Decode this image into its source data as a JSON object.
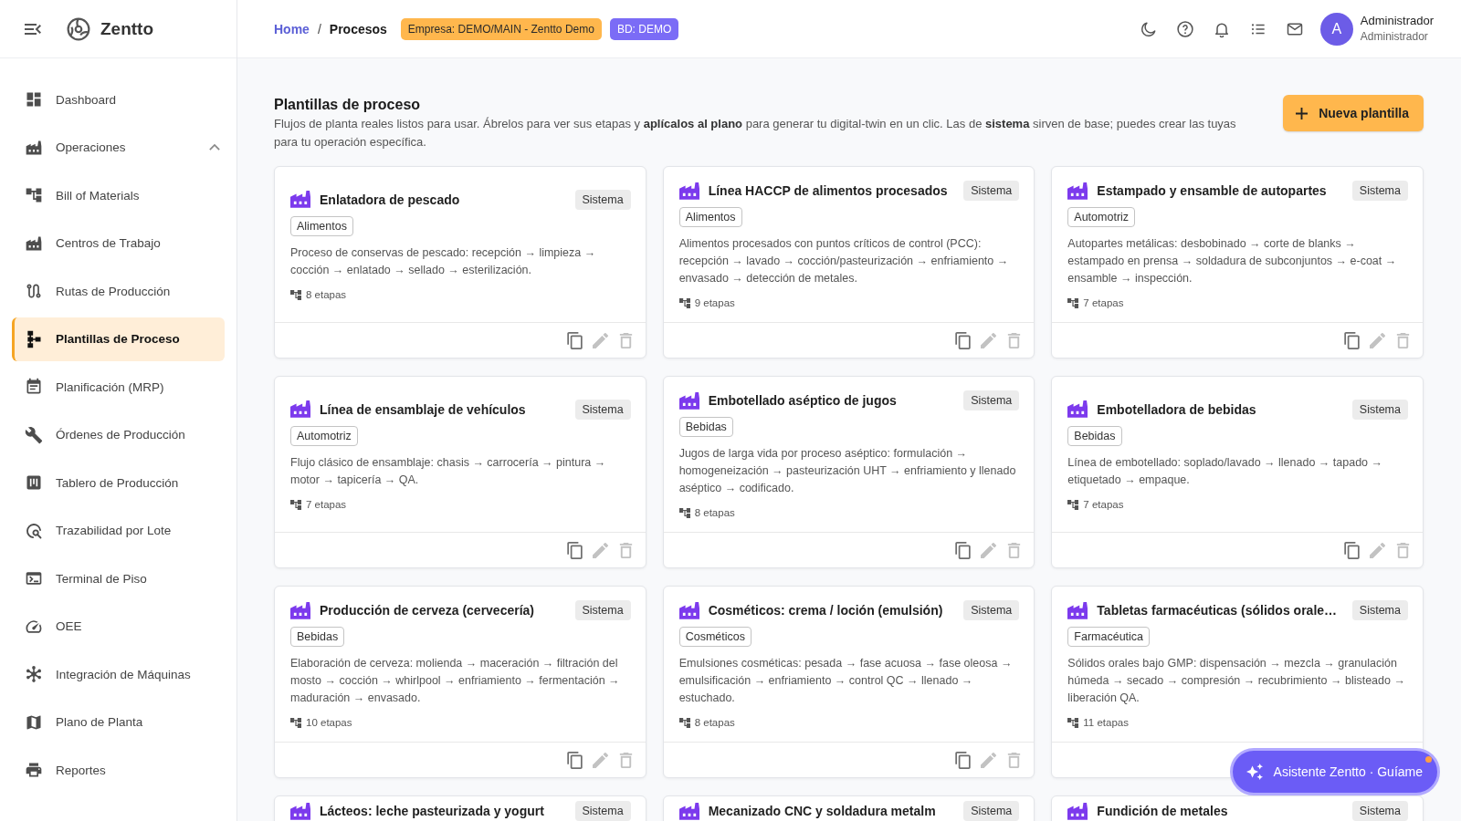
{
  "sidebar": {
    "brand": "Zentto",
    "items": [
      {
        "label": "Dashboard",
        "selected": false
      },
      {
        "label": "Operaciones",
        "selected": false,
        "expanded": true
      },
      {
        "label": "Bill of Materials",
        "selected": false
      },
      {
        "label": "Centros de Trabajo",
        "selected": false
      },
      {
        "label": "Rutas de Producción",
        "selected": false
      },
      {
        "label": "Plantillas de Proceso",
        "selected": true
      },
      {
        "label": "Planificación (MRP)",
        "selected": false
      },
      {
        "label": "Órdenes de Producción",
        "selected": false
      },
      {
        "label": "Tablero de Producción",
        "selected": false
      },
      {
        "label": "Trazabilidad por Lote",
        "selected": false
      },
      {
        "label": "Terminal de Piso",
        "selected": false
      },
      {
        "label": "OEE",
        "selected": false
      },
      {
        "label": "Integración de Máquinas",
        "selected": false
      },
      {
        "label": "Plano de Planta",
        "selected": false
      },
      {
        "label": "Reportes",
        "selected": false
      }
    ]
  },
  "header": {
    "breadcrumb": {
      "items": [
        "Home",
        "Procesos"
      ],
      "separator": "/"
    },
    "badges": [
      {
        "label": "Empresa: DEMO/MAIN - Zentto Demo",
        "color": "#ffb74d"
      },
      {
        "label": "BD: DEMO",
        "color": "#7b6cf6"
      }
    ],
    "user": {
      "initial": "A",
      "name": "Administrador",
      "role": "Administrador"
    }
  },
  "page": {
    "title": "Plantillas de proceso",
    "description": "Flujos de planta reales listos para usar. Ábrelos para ver sus etapas y **aplícalos al plano** para generar tu digital-twin en un clic. Las de **sistema** sirven de base; puedes crear las tuyas para tu operación específica.",
    "new_button": "Nueva plantilla"
  },
  "templates": [
    {
      "name": "Enlatadora de pescado",
      "badge": "Sistema",
      "category": "Alimentos",
      "description": "Proceso de conservas de pescado: recepción → limpieza → cocción → enlatado → sellado → esterilización.",
      "stages": "8 etapas",
      "locked": true
    },
    {
      "name": "Línea HACCP de alimentos procesados",
      "badge": "Sistema",
      "category": "Alimentos",
      "description": "Alimentos procesados con puntos críticos de control (PCC): recepción → lavado → cocción/pasteurización → enfriamiento → envasado → detección de metales.",
      "stages": "9 etapas",
      "locked": true
    },
    {
      "name": "Estampado y ensamble de autopartes",
      "badge": "Sistema",
      "category": "Automotriz",
      "description": "Autopartes metálicas: desbobinado → corte de blanks → estampado en prensa → soldadura de subconjuntos → e-coat → ensamble → inspección.",
      "stages": "7 etapas",
      "locked": true
    },
    {
      "name": "Línea de ensamblaje de vehículos",
      "badge": "Sistema",
      "category": "Automotriz",
      "description": "Flujo clásico de ensamblaje: chasis → carrocería → pintura → motor → tapicería → QA.",
      "stages": "7 etapas",
      "locked": true
    },
    {
      "name": "Embotellado aséptico de jugos",
      "badge": "Sistema",
      "category": "Bebidas",
      "description": "Jugos de larga vida por proceso aséptico: formulación → homogeneización → pasteurización UHT → enfriamiento y llenado aséptico → codificado.",
      "stages": "8 etapas",
      "locked": true
    },
    {
      "name": "Embotelladora de bebidas",
      "badge": "Sistema",
      "category": "Bebidas",
      "description": "Línea de embotellado: soplado/lavado → llenado → tapado → etiquetado → empaque.",
      "stages": "7 etapas",
      "locked": true
    },
    {
      "name": "Producción de cerveza (cervecería)",
      "badge": "Sistema",
      "category": "Bebidas",
      "description": "Elaboración de cerveza: molienda → maceración → filtración del mosto → cocción → whirlpool → enfriamiento → fermentación → maduración → envasado.",
      "stages": "10 etapas",
      "locked": true
    },
    {
      "name": "Cosméticos: crema / loción (emulsión)",
      "badge": "Sistema",
      "category": "Cosméticos",
      "description": "Emulsiones cosméticas: pesada → fase acuosa → fase oleosa → emulsificación → enfriamiento → control QC → llenado → estuchado.",
      "stages": "8 etapas",
      "locked": true
    },
    {
      "name": "Tabletas farmacéuticas (sólidos orale…",
      "badge": "Sistema",
      "category": "Farmacéutica",
      "description": "Sólidos orales bajo GMP: dispensación → mezcla → granulación húmeda → secado → compresión → recubrimiento → blisteado → liberación QA.",
      "stages": "11 etapas"
    },
    {
      "name": "Lácteos: leche pasteurizada y yogurt",
      "badge": "Sistema"
    },
    {
      "name": "Mecanizado CNC y soldadura metalm",
      "badge": "Sistema"
    },
    {
      "name": "Fundición de metales",
      "badge": "Sistema"
    }
  ],
  "assistant_button": {
    "label": "Asistente Zentto · Guíame",
    "notification": true
  }
}
